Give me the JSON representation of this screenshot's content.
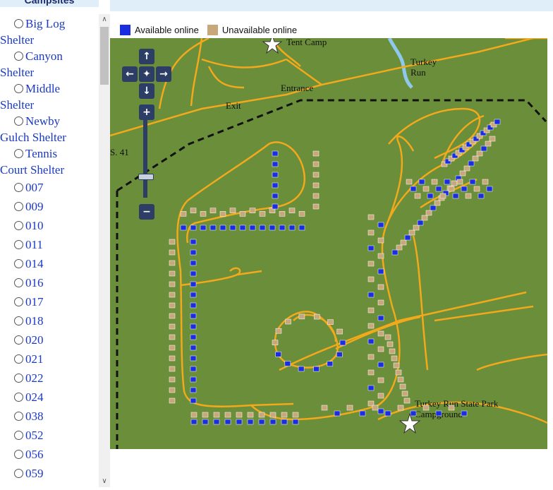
{
  "sidebar": {
    "header": "Campsites",
    "items": [
      {
        "label": "Big Log Shelter",
        "line1": "Big Log",
        "line2": "Shelter"
      },
      {
        "label": "Canyon Shelter",
        "line1": "Canyon",
        "line2": "Shelter"
      },
      {
        "label": "Middle Shelter",
        "line1": "Middle",
        "line2": "Shelter"
      },
      {
        "label": "Newby Gulch Shelter",
        "line1": "Newby",
        "line2": "Gulch Shelter"
      },
      {
        "label": "Tennis Court Shelter",
        "line1": "Tennis",
        "line2": "Court Shelter"
      },
      {
        "label": "007"
      },
      {
        "label": "009"
      },
      {
        "label": "010"
      },
      {
        "label": "011"
      },
      {
        "label": "014"
      },
      {
        "label": "016"
      },
      {
        "label": "017"
      },
      {
        "label": "018"
      },
      {
        "label": "020"
      },
      {
        "label": "021"
      },
      {
        "label": "022"
      },
      {
        "label": "024"
      },
      {
        "label": "038"
      },
      {
        "label": "052"
      },
      {
        "label": "056"
      },
      {
        "label": "059"
      }
    ]
  },
  "legend": {
    "available": {
      "label": "Available online",
      "color": "#1a2ee0"
    },
    "unavailable": {
      "label": "Unavailable online",
      "color": "#c8a87a"
    }
  },
  "map": {
    "labels": {
      "tent_camp": "Tent Camp",
      "turkey_run": "Turkey Run",
      "entrance": "Entrance",
      "exit": "Exit",
      "route": "S. 41",
      "campground": "Turkey Run State Park Campground"
    },
    "colors": {
      "grass": "#6b8e3a",
      "road": "#f2a91c",
      "water": "#8fc8ea",
      "boundary": "#111111"
    },
    "controls": {
      "pan_up": "up-arrow-icon",
      "pan_down": "down-arrow-icon",
      "pan_left": "left-arrow-icon",
      "pan_right": "right-arrow-icon",
      "zoom_in": "plus-icon",
      "zoom_out": "minus-icon"
    }
  }
}
